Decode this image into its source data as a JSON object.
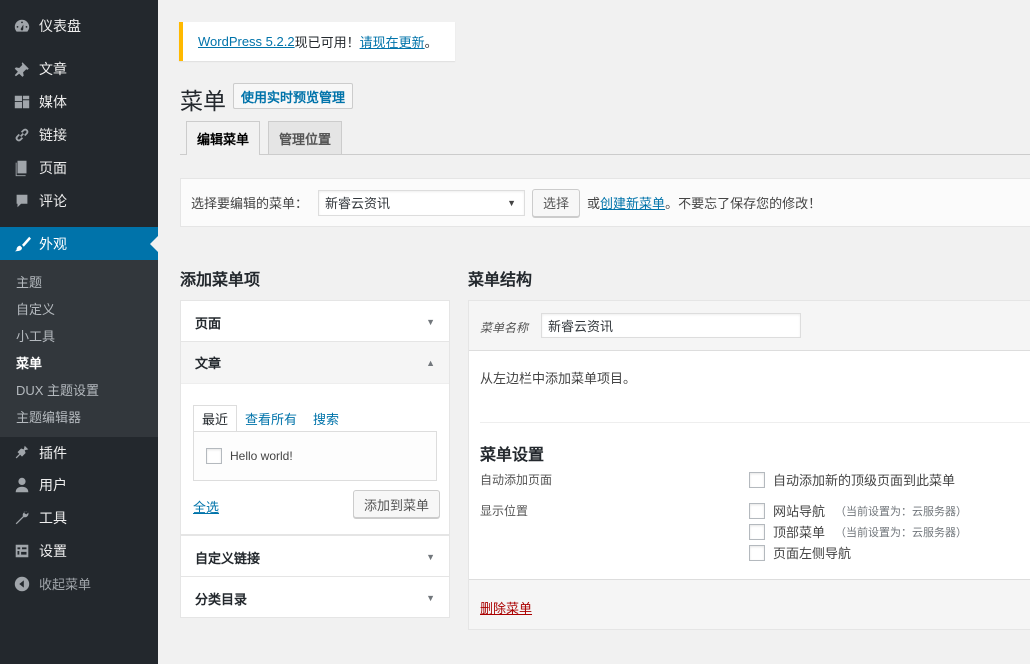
{
  "sidebar": {
    "items": [
      {
        "label": "仪表盘",
        "icon": "dashboard-icon"
      },
      {
        "label": "文章",
        "icon": "pin-icon"
      },
      {
        "label": "媒体",
        "icon": "media-icon"
      },
      {
        "label": "链接",
        "icon": "link-icon"
      },
      {
        "label": "页面",
        "icon": "page-icon"
      },
      {
        "label": "评论",
        "icon": "comment-icon"
      },
      {
        "label": "外观",
        "icon": "brush-icon"
      },
      {
        "label": "插件",
        "icon": "plugin-icon"
      },
      {
        "label": "用户",
        "icon": "user-icon"
      },
      {
        "label": "工具",
        "icon": "wrench-icon"
      },
      {
        "label": "设置",
        "icon": "settings-icon"
      },
      {
        "label": "收起菜单",
        "icon": "collapse-icon"
      }
    ],
    "submenu": [
      "主题",
      "自定义",
      "小工具",
      "菜单",
      "DUX 主题设置",
      "主题编辑器"
    ],
    "current": "外观",
    "current_sub": "菜单"
  },
  "notice": {
    "version_link": "WordPress 5.2.2",
    "middle": "现已可用！",
    "update_link": "请现在更新",
    "end": "。"
  },
  "page": {
    "title": "菜单",
    "preview_button": "使用实时预览管理",
    "tabs": [
      "编辑菜单",
      "管理位置"
    ]
  },
  "manage": {
    "label": "选择要编辑的菜单：",
    "selected": "新睿云资讯",
    "select_button": "选择",
    "or": "或",
    "create_link": "创建新菜单",
    "tail": "。不要忘了保存您的修改！"
  },
  "add_items": {
    "title": "添加菜单项",
    "sections": [
      "页面",
      "文章",
      "自定义链接",
      "分类目录"
    ],
    "post_tabs": [
      "最近",
      "查看所有",
      "搜索"
    ],
    "post_item": "Hello world!",
    "select_all": "全选",
    "add_button": "添加到菜单"
  },
  "structure": {
    "title": "菜单结构",
    "name_label": "菜单名称",
    "name_value": "新睿云资讯",
    "hint": "从左边栏中添加菜单项目。",
    "settings_title": "菜单设置",
    "auto_add_label": "自动添加页面",
    "auto_add_option": "自动添加新的顶级页面到此菜单",
    "location_label": "显示位置",
    "locations": [
      {
        "label": "网站导航",
        "note": "（当前设置为：云服务器）"
      },
      {
        "label": "顶部菜单",
        "note": "（当前设置为：云服务器）"
      },
      {
        "label": "页面左侧导航",
        "note": ""
      }
    ],
    "delete_link": "删除菜单"
  },
  "colors": {
    "sidebar_bg": "#23282d",
    "accent": "#0073aa",
    "notice_border": "#ffb900",
    "delete": "#a00000"
  }
}
